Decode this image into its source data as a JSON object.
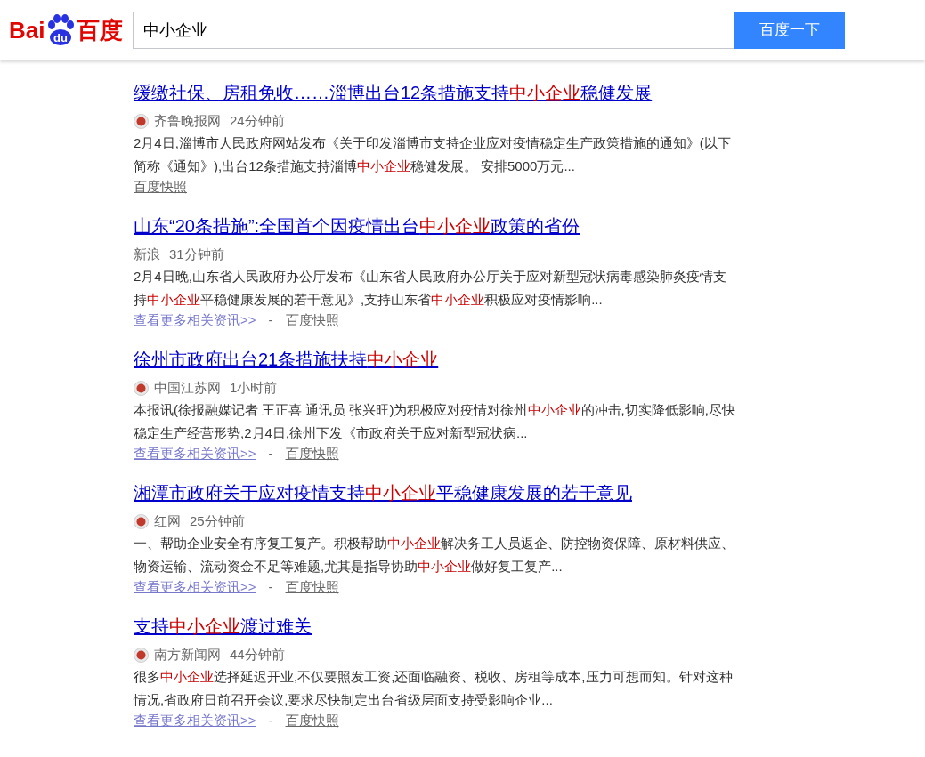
{
  "header": {
    "logo": {
      "left": "Bai",
      "badge": "du",
      "right": "百度"
    },
    "search": {
      "value": "中小企业"
    },
    "button": "百度一下"
  },
  "results": [
    {
      "title": [
        {
          "text": "缓缴社保、房租免收……淄博出台12条措施支持",
          "highlight": false
        },
        {
          "text": "中小企业",
          "highlight": true
        },
        {
          "text": "稳健发展",
          "highlight": false
        }
      ],
      "source": "齐鲁晚报网",
      "icon": true,
      "time": "24分钟前",
      "snippet": [
        {
          "text": "2月4日,淄博市人民政府网站发布《关于印发淄博市支持企业应对疫情稳定生产政策措施的通知》(以下简称《通知》),出台12条措施支持淄博",
          "highlight": false
        },
        {
          "text": "中小企业",
          "highlight": true
        },
        {
          "text": "稳健发展。 安排5000万元...",
          "highlight": false
        }
      ],
      "links": [
        {
          "kind": "snapshot",
          "text": "百度快照"
        }
      ]
    },
    {
      "title": [
        {
          "text": "山东“20条措施”:全国首个因疫情出台",
          "highlight": false
        },
        {
          "text": "中小企业",
          "highlight": true
        },
        {
          "text": "政策的省份",
          "highlight": false
        }
      ],
      "source": "新浪",
      "icon": false,
      "time": "31分钟前",
      "snippet": [
        {
          "text": "2月4日晚,山东省人民政府办公厅发布《山东省人民政府办公厅关于应对新型冠状病毒感染肺炎疫情支持",
          "highlight": false
        },
        {
          "text": "中小企业",
          "highlight": true
        },
        {
          "text": "平稳健康发展的若干意见》,支持山东省",
          "highlight": false
        },
        {
          "text": "中小企业",
          "highlight": true
        },
        {
          "text": "积极应对疫情影响...",
          "highlight": false
        }
      ],
      "links": [
        {
          "kind": "more",
          "text": "查看更多相关资讯>>"
        },
        {
          "kind": "separator",
          "text": "-"
        },
        {
          "kind": "snapshot",
          "text": "百度快照"
        }
      ]
    },
    {
      "title": [
        {
          "text": "徐州市政府出台21条措施扶持",
          "highlight": false
        },
        {
          "text": "中小企业",
          "highlight": true
        }
      ],
      "source": "中国江苏网",
      "icon": true,
      "time": "1小时前",
      "snippet": [
        {
          "text": "本报讯(徐报融媒记者 王正喜 通讯员 张兴旺)为积极应对疫情对徐州",
          "highlight": false
        },
        {
          "text": "中小企业",
          "highlight": true
        },
        {
          "text": "的冲击,切实降低影响,尽快稳定生产经营形势,2月4日,徐州下发《市政府关于应对新型冠状病...",
          "highlight": false
        }
      ],
      "links": [
        {
          "kind": "more",
          "text": "查看更多相关资讯>>"
        },
        {
          "kind": "separator",
          "text": "-"
        },
        {
          "kind": "snapshot",
          "text": "百度快照"
        }
      ]
    },
    {
      "title": [
        {
          "text": "湘潭市政府关于应对疫情支持",
          "highlight": false
        },
        {
          "text": "中小企业",
          "highlight": true
        },
        {
          "text": "平稳健康发展的若干意见",
          "highlight": false
        }
      ],
      "source": "红网",
      "icon": true,
      "time": "25分钟前",
      "snippet": [
        {
          "text": "一、帮助企业安全有序复工复产。积极帮助",
          "highlight": false
        },
        {
          "text": "中小企业",
          "highlight": true
        },
        {
          "text": "解决务工人员返企、防控物资保障、原材料供应、物资运输、流动资金不足等难题,尤其是指导协助",
          "highlight": false
        },
        {
          "text": "中小企业",
          "highlight": true
        },
        {
          "text": "做好复工复产...",
          "highlight": false
        }
      ],
      "links": [
        {
          "kind": "more",
          "text": "查看更多相关资讯>>"
        },
        {
          "kind": "separator",
          "text": "-"
        },
        {
          "kind": "snapshot",
          "text": "百度快照"
        }
      ]
    },
    {
      "title": [
        {
          "text": "支持",
          "highlight": false
        },
        {
          "text": "中小企业",
          "highlight": true
        },
        {
          "text": "渡过难关",
          "highlight": false
        }
      ],
      "source": "南方新闻网",
      "icon": true,
      "time": "44分钟前",
      "snippet": [
        {
          "text": "很多",
          "highlight": false
        },
        {
          "text": "中小企业",
          "highlight": true
        },
        {
          "text": "选择延迟开业,不仅要照发工资,还面临融资、税收、房租等成本,压力可想而知。针对这种情况,省政府日前召开会议,要求尽快制定出台省级层面支持受影响企业...",
          "highlight": false
        }
      ],
      "links": [
        {
          "kind": "more",
          "text": "查看更多相关资讯>>"
        },
        {
          "kind": "separator",
          "text": "-"
        },
        {
          "kind": "snapshot",
          "text": "百度快照"
        }
      ]
    }
  ]
}
